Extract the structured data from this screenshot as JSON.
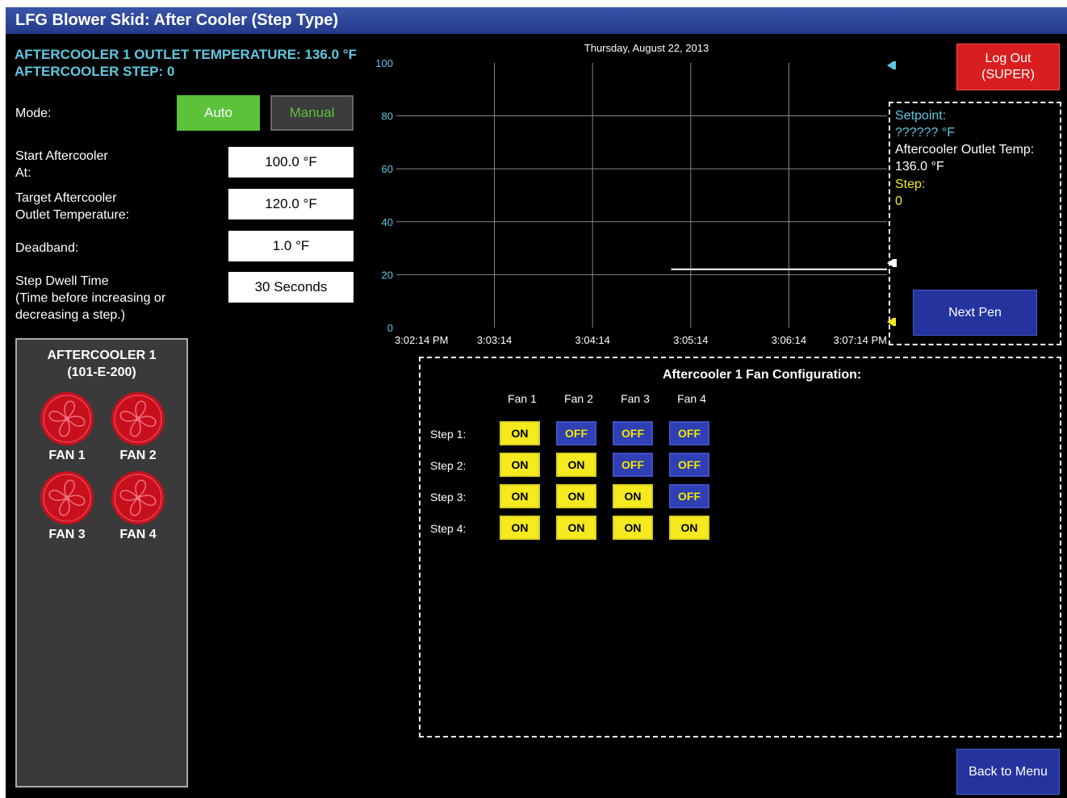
{
  "window": {
    "title": "LFG Blower Skid: After Cooler (Step Type)"
  },
  "status": {
    "outlet_temp_line": "AFTERCOOLER 1 OUTLET TEMPERATURE: 136.0 °F",
    "step_line": "AFTERCOOLER STEP: 0"
  },
  "mode": {
    "label": "Mode:",
    "auto_label": "Auto",
    "manual_label": "Manual",
    "selected": "Auto"
  },
  "settings": {
    "start_label_1": "Start Aftercooler",
    "start_label_2": "At:",
    "start_value": "100.0 °F",
    "target_label_1": "Target Aftercooler",
    "target_label_2": "Outlet Temperature:",
    "target_value": "120.0 °F",
    "deadband_label": "Deadband:",
    "deadband_value": "1.0 °F",
    "dwell_label_1": "Step Dwell Time",
    "dwell_label_2": "(Time before increasing or",
    "dwell_label_3": "decreasing a step.)",
    "dwell_value": "30 Seconds"
  },
  "fan_panel": {
    "title_1": "AFTERCOOLER 1",
    "title_2": "(101-E-200)",
    "fans": [
      "FAN 1",
      "FAN 2",
      "FAN 3",
      "FAN 4"
    ]
  },
  "trend": {
    "date": "Thursday, August 22, 2013",
    "y_ticks": [
      "100",
      "80",
      "60",
      "40",
      "20",
      "0"
    ],
    "x_ticks": [
      "3:02:14 PM",
      "3:03:14",
      "3:04:14",
      "3:05:14",
      "3:06:14",
      "3:07:14 PM"
    ],
    "colors": {
      "grid": "#888888",
      "axis_labels": "#5fc8e0",
      "pen": "#ffffff"
    }
  },
  "chart_data": {
    "type": "line",
    "title": "",
    "ylim": [
      0,
      100
    ],
    "x": [
      "3:02:14 PM",
      "3:03:14",
      "3:04:14",
      "3:05:14",
      "3:06:14",
      "3:07:14 PM"
    ],
    "series": [
      {
        "values": [
          null,
          null,
          null,
          22,
          22,
          22
        ]
      }
    ],
    "grid": true
  },
  "legend": {
    "setpoint_label": "Setpoint:",
    "setpoint_value": "?????? °F",
    "outlet_label": "Aftercooler Outlet Temp:",
    "outlet_value": "136.0 °F",
    "step_label": "Step:",
    "step_value": "0",
    "colors": {
      "setpoint": "#5fc8e0",
      "outlet": "#ffffff",
      "step": "#f5ea1e"
    }
  },
  "buttons": {
    "logout_line1": "Log Out",
    "logout_line2": "(SUPER)",
    "next_pen": "Next Pen",
    "back_to_menu": "Back to Menu"
  },
  "fan_config": {
    "title": "Aftercooler 1 Fan Configuration:",
    "columns": [
      "Fan 1",
      "Fan 2",
      "Fan 3",
      "Fan 4"
    ],
    "rows": [
      {
        "label": "Step 1:",
        "states": [
          "ON",
          "OFF",
          "OFF",
          "OFF"
        ]
      },
      {
        "label": "Step 2:",
        "states": [
          "ON",
          "ON",
          "OFF",
          "OFF"
        ]
      },
      {
        "label": "Step 3:",
        "states": [
          "ON",
          "ON",
          "ON",
          "OFF"
        ]
      },
      {
        "label": "Step 4:",
        "states": [
          "ON",
          "ON",
          "ON",
          "ON"
        ]
      }
    ]
  }
}
